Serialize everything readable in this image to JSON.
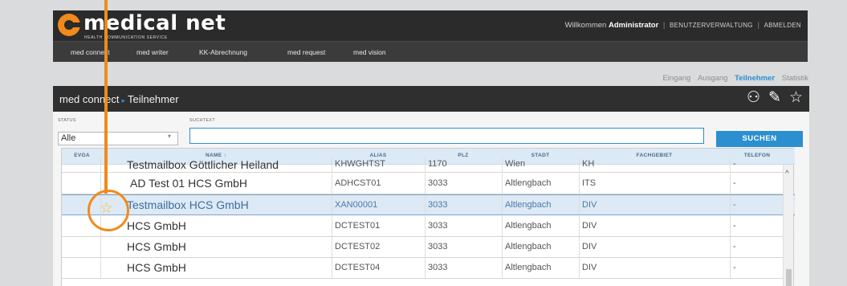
{
  "brand": {
    "name": "medical net",
    "tagline": "HEALTH COMMUNICATION SERVICE",
    "accent": "#f08a1c"
  },
  "user": {
    "welcome": "Willkommen",
    "name": "Administrator",
    "usermgmt": "BENUTZERVERWALTUNG",
    "logout": "ABMELDEN"
  },
  "nav": [
    "med connect",
    "med writer",
    "KK-Abrechnung",
    "med request",
    "med vision"
  ],
  "subnav": {
    "items": [
      "Eingang",
      "Ausgang",
      "Teilnehmer",
      "Statistik"
    ],
    "active": "Teilnehmer"
  },
  "panel": {
    "section": "med connect",
    "page": "Teilnehmer",
    "icons": [
      "add-user-icon",
      "pencil-icon",
      "star-icon"
    ]
  },
  "filters": {
    "status_label": "STATUS",
    "status_value": "Alle",
    "search_label": "SUCHTEXT",
    "search_value": "",
    "search_button": "SUCHEN"
  },
  "table": {
    "columns": [
      "EVGA",
      "NAME ↑",
      "ALIAS",
      "PLZ",
      "STADT",
      "FACHGEBIET",
      "TELEFON"
    ],
    "rows": [
      {
        "name": "Testmailbox Göttlicher Heiland",
        "alias": "KHWGHTST",
        "plz": "1170",
        "stadt": "Wien",
        "fach": "KH",
        "tel": "-"
      },
      {
        "name": "AD Test 01 HCS GmbH",
        "alias": "ADHCST01",
        "plz": "3033",
        "stadt": "Altlengbach",
        "fach": "ITS",
        "tel": "-"
      },
      {
        "name": "Testmailbox HCS GmbH",
        "alias": "XAN00001",
        "plz": "3033",
        "stadt": "Altlengbach",
        "fach": "DIV",
        "tel": "-",
        "selected": true
      },
      {
        "name": "HCS GmbH",
        "alias": "DCTEST01",
        "plz": "3033",
        "stadt": "Altlengbach",
        "fach": "DIV",
        "tel": "-"
      },
      {
        "name": "HCS GmbH",
        "alias": "DCTEST02",
        "plz": "3033",
        "stadt": "Altlengbach",
        "fach": "DIV",
        "tel": "-"
      },
      {
        "name": "HCS GmbH",
        "alias": "DCTEST04",
        "plz": "3033",
        "stadt": "Altlengbach",
        "fach": "DIV",
        "tel": "-"
      }
    ]
  }
}
